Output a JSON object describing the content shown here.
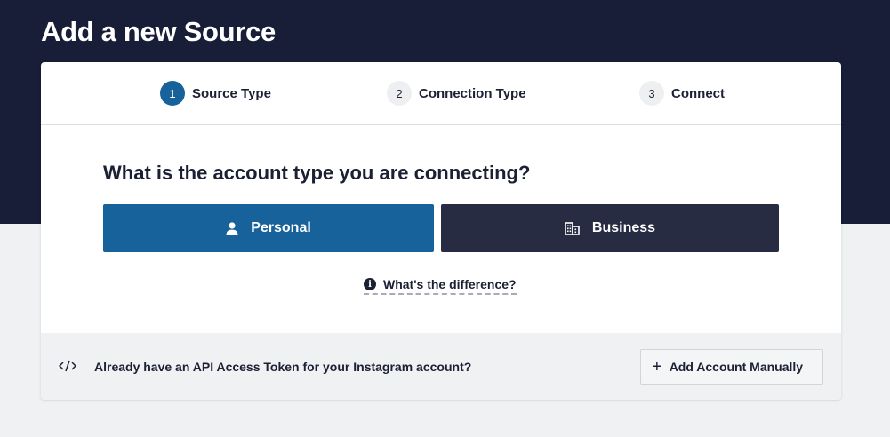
{
  "page": {
    "title": "Add a new Source"
  },
  "stepper": {
    "steps": [
      {
        "number": "1",
        "label": "Source Type",
        "active": true
      },
      {
        "number": "2",
        "label": "Connection Type",
        "active": false
      },
      {
        "number": "3",
        "label": "Connect",
        "active": false
      }
    ]
  },
  "main": {
    "question": "What is the account type you are connecting?",
    "options": [
      {
        "label": "Personal",
        "icon": "person-icon",
        "color": "#17629a"
      },
      {
        "label": "Business",
        "icon": "building-icon",
        "color": "#282c43"
      }
    ],
    "difference_link": "What's the difference?"
  },
  "footer": {
    "icon": "code-icon",
    "text": "Already have an API Access Token for your Instagram account?",
    "button_label": "Add Account Manually"
  },
  "colors": {
    "header_bg": "#181d38",
    "accent": "#17629a",
    "page_bg": "#f0f1f3"
  }
}
